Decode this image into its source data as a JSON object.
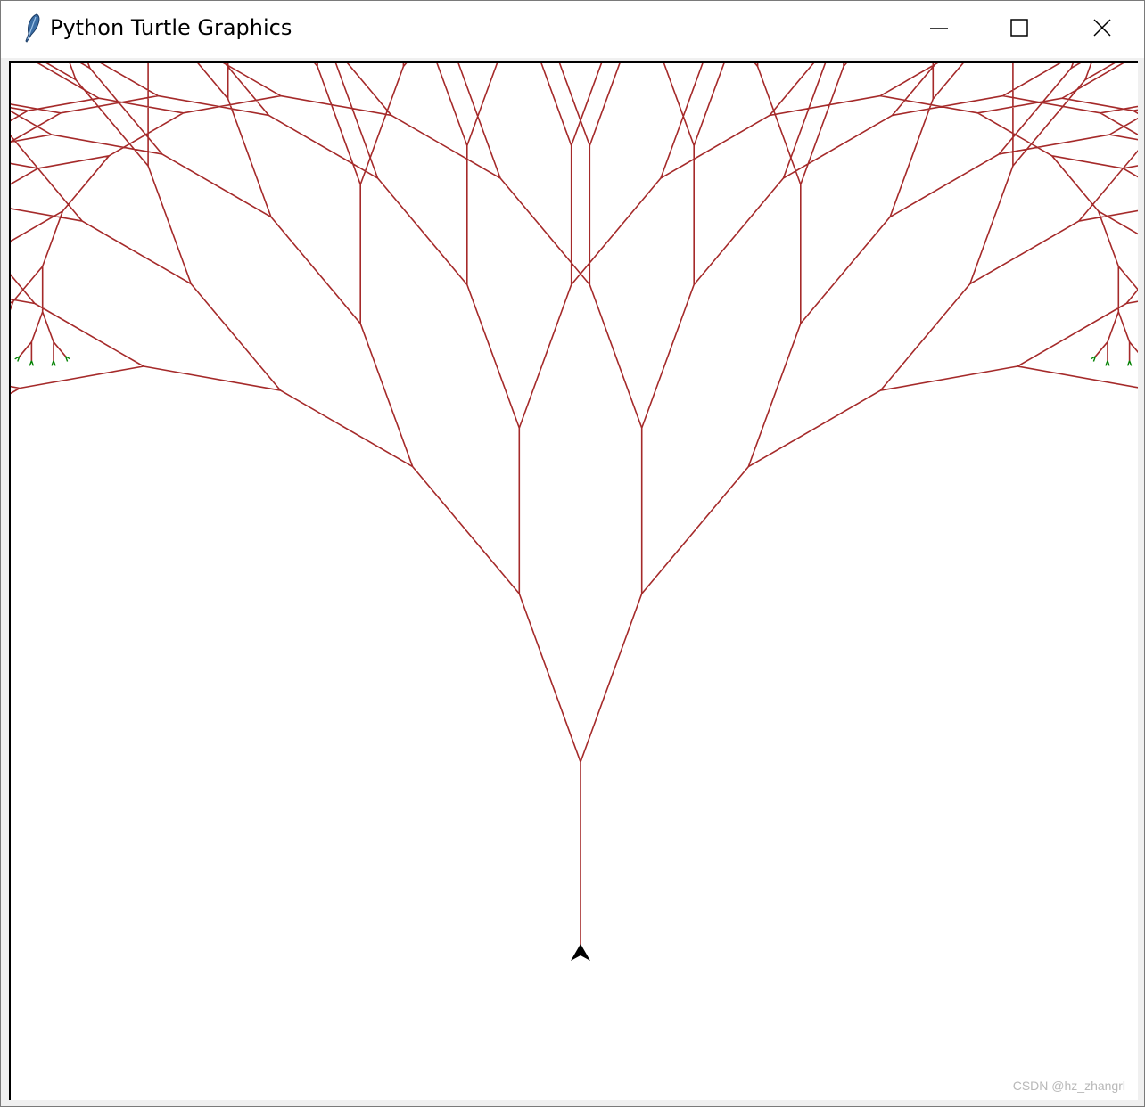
{
  "window": {
    "title": "Python Turtle Graphics",
    "icon": "feather-icon",
    "controls": {
      "minimize": "minimize-icon",
      "maximize": "maximize-icon",
      "close": "close-icon"
    }
  },
  "canvas": {
    "background": "#ffffff",
    "drawing": "fractal-tree",
    "branch_color": "#a52a2a",
    "leaf_color": "#008000",
    "turtle_cursor": "turtle-arrow-icon"
  },
  "watermark": "CSDN @hz_zhangrl"
}
